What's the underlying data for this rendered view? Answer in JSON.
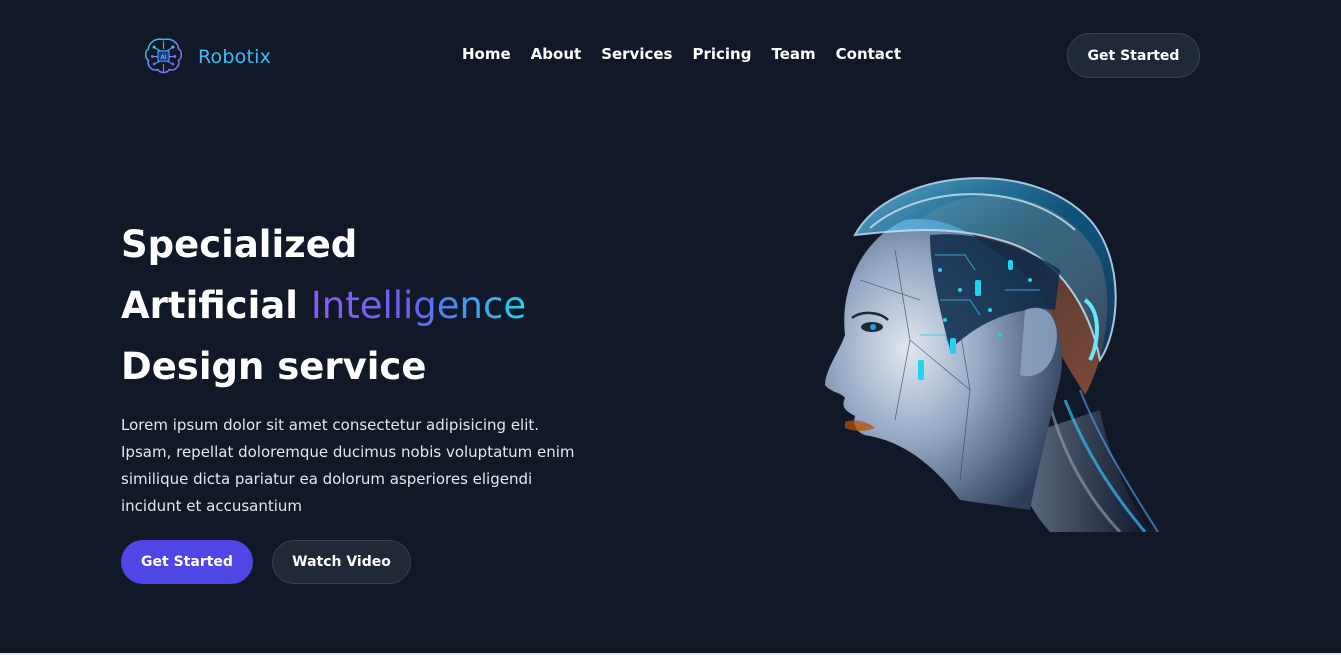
{
  "brand": {
    "name": "Robotix",
    "logo_icon": "ai-brain-icon",
    "color": "#38bdf8"
  },
  "nav": {
    "items": [
      {
        "label": "Home"
      },
      {
        "label": "About"
      },
      {
        "label": "Services"
      },
      {
        "label": "Pricing"
      },
      {
        "label": "Team"
      },
      {
        "label": "Contact"
      }
    ]
  },
  "header": {
    "cta_label": "Get Started"
  },
  "hero": {
    "title_line1": "Specialized",
    "title_line2_start": "Artificial ",
    "title_line2_accent": "Intelligence",
    "title_line3": "Design service",
    "description": "Lorem ipsum dolor sit amet consectetur adipisicing elit. Ipsam, repellat doloremque ducimus nobis voluptatum enim similique dicta pariatur ea dolorum asperiores eligendi incidunt et accusantium",
    "primary_button": "Get Started",
    "secondary_button": "Watch Video",
    "image_icon": "robot-head-illustration"
  },
  "colors": {
    "background": "#111827",
    "primary_button": "#4f46e5",
    "secondary_button": "#1f2937",
    "accent_start": "#8b5cf6",
    "accent_end": "#22d3ee"
  }
}
